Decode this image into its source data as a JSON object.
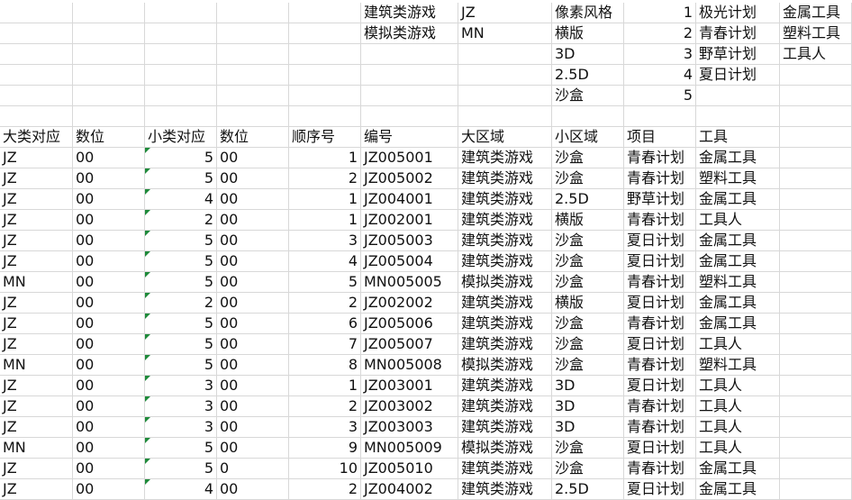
{
  "lookup_rows": [
    [
      "",
      "",
      "",
      "",
      "",
      "建筑类游戏",
      "JZ",
      "像素风格",
      "1",
      "极光计划",
      "金属工具"
    ],
    [
      "",
      "",
      "",
      "",
      "",
      "模拟类游戏",
      "MN",
      "横版",
      "2",
      "青春计划",
      "塑料工具"
    ],
    [
      "",
      "",
      "",
      "",
      "",
      "",
      "",
      "3D",
      "3",
      "野草计划",
      "工具人"
    ],
    [
      "",
      "",
      "",
      "",
      "",
      "",
      "",
      "2.5D",
      "4",
      "夏日计划",
      ""
    ],
    [
      "",
      "",
      "",
      "",
      "",
      "",
      "",
      "沙盒",
      "5",
      "",
      ""
    ],
    [
      "",
      "",
      "",
      "",
      "",
      "",
      "",
      "",
      "",
      "",
      ""
    ]
  ],
  "headers": [
    "大类对应",
    "数位",
    "小类对应",
    "数位",
    "顺序号",
    "编号",
    "大区域",
    "小区域",
    "项目",
    "工具",
    ""
  ],
  "rows": [
    [
      "JZ",
      "00",
      "5",
      "00",
      "1",
      "JZ005001",
      "建筑类游戏",
      "沙盒",
      "青春计划",
      "金属工具",
      ""
    ],
    [
      "JZ",
      "00",
      "5",
      "00",
      "2",
      "JZ005002",
      "建筑类游戏",
      "沙盒",
      "青春计划",
      "塑料工具",
      ""
    ],
    [
      "JZ",
      "00",
      "4",
      "00",
      "1",
      "JZ004001",
      "建筑类游戏",
      "2.5D",
      "野草计划",
      "金属工具",
      ""
    ],
    [
      "JZ",
      "00",
      "2",
      "00",
      "1",
      "JZ002001",
      "建筑类游戏",
      "横版",
      "青春计划",
      "工具人",
      ""
    ],
    [
      "JZ",
      "00",
      "5",
      "00",
      "3",
      "JZ005003",
      "建筑类游戏",
      "沙盒",
      "夏日计划",
      "金属工具",
      ""
    ],
    [
      "JZ",
      "00",
      "5",
      "00",
      "4",
      "JZ005004",
      "建筑类游戏",
      "沙盒",
      "夏日计划",
      "金属工具",
      ""
    ],
    [
      "MN",
      "00",
      "5",
      "00",
      "5",
      "MN005005",
      "模拟类游戏",
      "沙盒",
      "青春计划",
      "塑料工具",
      ""
    ],
    [
      "JZ",
      "00",
      "2",
      "00",
      "2",
      "JZ002002",
      "建筑类游戏",
      "横版",
      "夏日计划",
      "金属工具",
      ""
    ],
    [
      "JZ",
      "00",
      "5",
      "00",
      "6",
      "JZ005006",
      "建筑类游戏",
      "沙盒",
      "青春计划",
      "金属工具",
      ""
    ],
    [
      "JZ",
      "00",
      "5",
      "00",
      "7",
      "JZ005007",
      "建筑类游戏",
      "沙盒",
      "夏日计划",
      "工具人",
      ""
    ],
    [
      "MN",
      "00",
      "5",
      "00",
      "8",
      "MN005008",
      "模拟类游戏",
      "沙盒",
      "青春计划",
      "塑料工具",
      ""
    ],
    [
      "JZ",
      "00",
      "3",
      "00",
      "1",
      "JZ003001",
      "建筑类游戏",
      "3D",
      "夏日计划",
      "工具人",
      ""
    ],
    [
      "JZ",
      "00",
      "3",
      "00",
      "2",
      "JZ003002",
      "建筑类游戏",
      "3D",
      "青春计划",
      "工具人",
      ""
    ],
    [
      "JZ",
      "00",
      "3",
      "00",
      "3",
      "JZ003003",
      "建筑类游戏",
      "3D",
      "青春计划",
      "工具人",
      ""
    ],
    [
      "MN",
      "00",
      "5",
      "00",
      "9",
      "MN005009",
      "模拟类游戏",
      "沙盒",
      "夏日计划",
      "工具人",
      ""
    ],
    [
      "JZ",
      "00",
      "5",
      "0",
      "10",
      "JZ005010",
      "建筑类游戏",
      "沙盒",
      "青春计划",
      "金属工具",
      ""
    ],
    [
      "JZ",
      "00",
      "4",
      "00",
      "2",
      "JZ004002",
      "建筑类游戏",
      "2.5D",
      "夏日计划",
      "金属工具",
      ""
    ]
  ],
  "colors": {
    "gridline": "#d8d8d8",
    "number_as_text_marker": "#1e8a3a"
  }
}
